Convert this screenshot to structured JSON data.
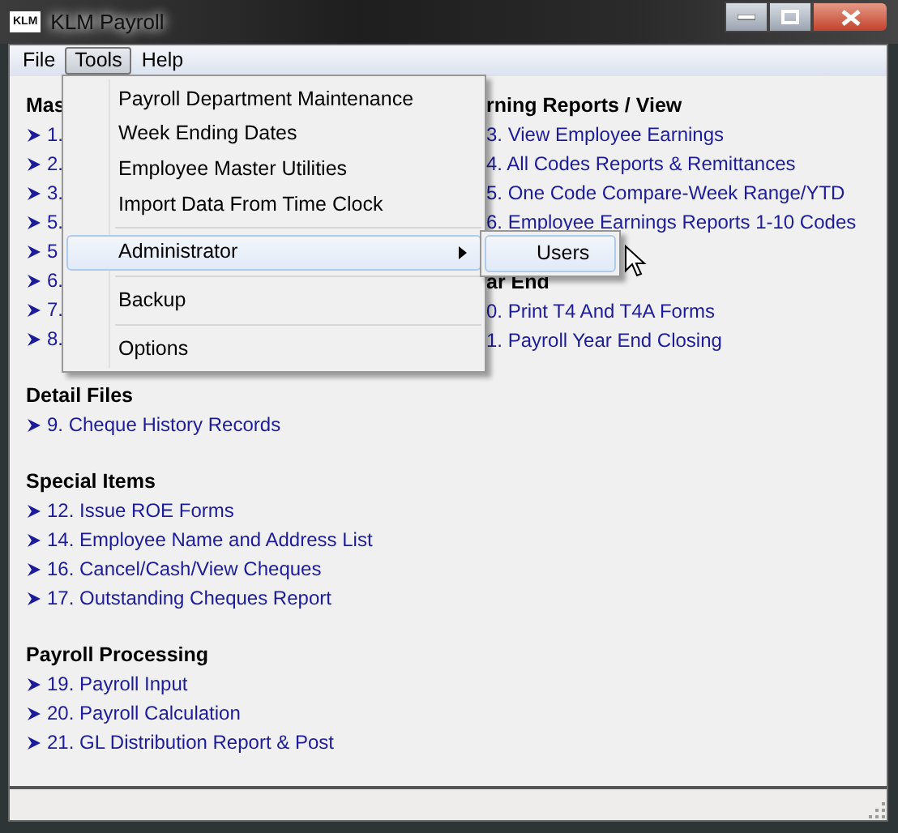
{
  "window": {
    "logo": "KLM",
    "title": "KLM Payroll"
  },
  "menu_bar": [
    {
      "label": "File",
      "selected": false
    },
    {
      "label": "Tools",
      "selected": true
    },
    {
      "label": "Help",
      "selected": false
    }
  ],
  "left_sections": [
    {
      "heading": "Mas",
      "items": [
        "1.",
        "2.",
        "3.",
        "5.",
        "5",
        "6.",
        "7.",
        "8."
      ]
    },
    {
      "heading": "Detail Files",
      "items": [
        "9. Cheque History Records"
      ]
    },
    {
      "heading": "Special Items",
      "items": [
        "12. Issue ROE Forms",
        "14. Employee Name and Address List",
        "16. Cancel/Cash/View Cheques",
        "17. Outstanding Cheques Report"
      ]
    },
    {
      "heading": "Payroll Processing",
      "items": [
        "19. Payroll Input",
        "20. Payroll Calculation",
        "21. GL Distribution Report & Post"
      ]
    }
  ],
  "right_sections": [
    {
      "heading": "rning Reports / View",
      "items": [
        "3. View Employee Earnings",
        "4. All Codes Reports & Remittances",
        "5. One Code Compare-Week Range/YTD",
        "6. Employee Earnings Reports 1-10 Codes"
      ]
    },
    {
      "heading": "ar End",
      "items": [
        "0. Print T4 And T4A Forms",
        "1. Payroll Year End Closing"
      ]
    }
  ],
  "tools_menu": [
    {
      "kind": "item",
      "label": "Payroll Department Maintenance"
    },
    {
      "kind": "item",
      "label": "Week Ending Dates"
    },
    {
      "kind": "item",
      "label": "Employee Master Utilities"
    },
    {
      "kind": "item",
      "label": "Import Data From Time Clock"
    },
    {
      "kind": "separator"
    },
    {
      "kind": "submenu",
      "label": "Administrator",
      "highlighted": true
    },
    {
      "kind": "separator"
    },
    {
      "kind": "item",
      "label": "Backup"
    },
    {
      "kind": "separator"
    },
    {
      "kind": "item",
      "label": "Options"
    }
  ],
  "submenu": [
    {
      "label": "Users",
      "highlighted": true
    }
  ]
}
